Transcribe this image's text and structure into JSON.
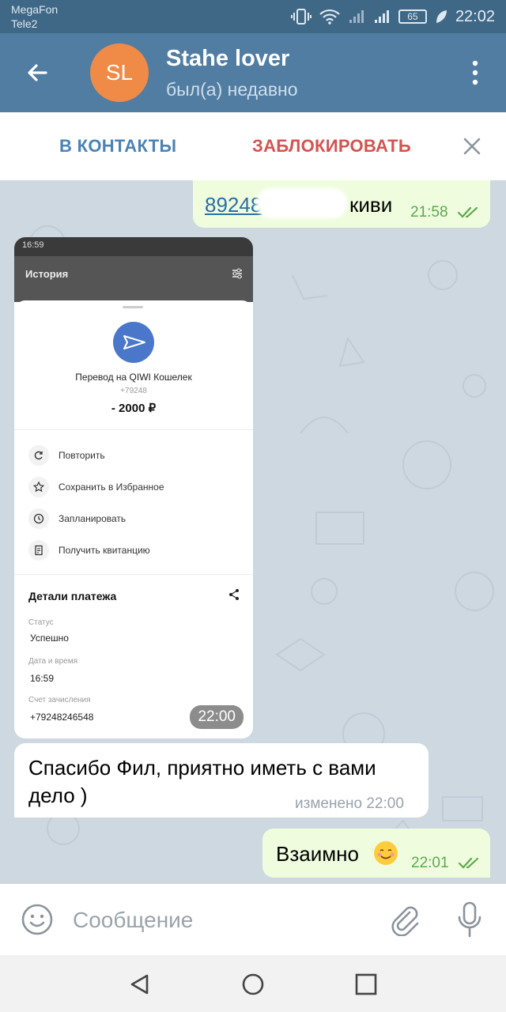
{
  "status_bar": {
    "carrier1": "MegaFon",
    "carrier2": "Tele2",
    "battery": "65",
    "time": "22:02"
  },
  "header": {
    "avatar_initials": "SL",
    "name": "Stahe lover",
    "status": "был(а) недавно",
    "avatar_color": "#f08a47"
  },
  "actions": {
    "add_contact": "В КОНТАКТЫ",
    "block": "ЗАБЛОКИРОВАТЬ"
  },
  "messages": {
    "m1": {
      "link": "89248",
      "text": "киви",
      "time": "21:58"
    },
    "m2": {
      "time": "22:00"
    },
    "m3": {
      "text_line1": "Спасибо Фил, приятно иметь с вами",
      "text_line2": "дело )",
      "edited": "изменено 22:00"
    },
    "m4": {
      "text": "Взаимно",
      "emoji": "☺️",
      "time": "22:01"
    }
  },
  "screenshot": {
    "status_time": "16:59",
    "header_title": "История",
    "transfer_title": "Перевод на QIWI Кошелек",
    "phone_partial": "+79248",
    "amount": "- 2000 ₽",
    "options": [
      "Повторить",
      "Сохранить в Избранное",
      "Запланировать",
      "Получить квитанцию"
    ],
    "details_title": "Детали платежа",
    "status_label": "Статус",
    "status_value": "Успешно",
    "datetime_label": "Дата и время",
    "datetime_value": "16:59",
    "account_label": "Счет зачисления",
    "account_value": "+79248246548"
  },
  "input": {
    "placeholder": "Сообщение"
  },
  "colors": {
    "header_bg": "#517da2",
    "outgoing_bubble": "#effdde",
    "incoming_bubble": "#ffffff",
    "accent_blue": "#4a82b5",
    "block_red": "#d35350"
  }
}
